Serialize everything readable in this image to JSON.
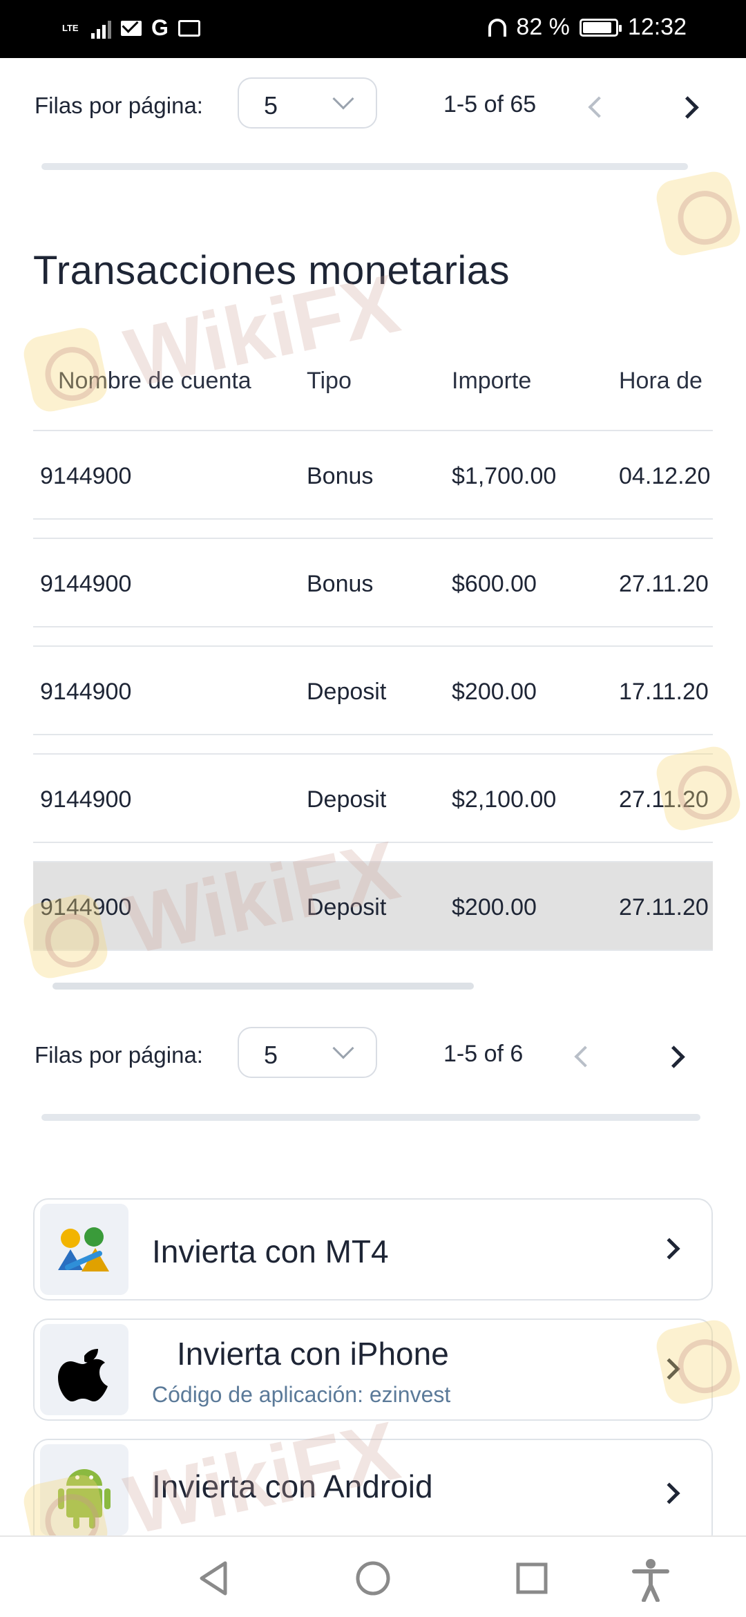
{
  "status_bar": {
    "network": "LTE",
    "battery": "82 %",
    "time": "12:32"
  },
  "pager_top": {
    "label": "Filas por página:",
    "rows_value": "5",
    "range": "1-5 of 65"
  },
  "section": {
    "title": "Transacciones monetarias"
  },
  "table": {
    "columns": [
      "Nombre de cuenta",
      "Tipo",
      "Importe",
      "Hora de"
    ],
    "rows": [
      [
        "9144900",
        "Bonus",
        "$1,700.00",
        "04.12.20"
      ],
      [
        "9144900",
        "Bonus",
        "$600.00",
        "27.11.20"
      ],
      [
        "9144900",
        "Deposit",
        "$200.00",
        "17.11.20"
      ],
      [
        "9144900",
        "Deposit",
        "$2,100.00",
        "27.11.20"
      ],
      [
        "9144900",
        "Deposit",
        "$200.00",
        "27.11.20"
      ]
    ]
  },
  "pager_bottom": {
    "label": "Filas por página:",
    "rows_value": "5",
    "range": "1-5 of 6"
  },
  "app_links": [
    {
      "title": "Invierta con MT4",
      "subtitle": "",
      "icon": "mt4-icon"
    },
    {
      "title": "Invierta con iPhone",
      "subtitle": "Código de aplicación: ezinvest",
      "icon": "apple-icon"
    },
    {
      "title": "Invierta con Android",
      "subtitle": "",
      "icon": "android-icon"
    }
  ],
  "watermark": {
    "text": "WikiFX"
  },
  "colors": {
    "text": "#1e2535",
    "subtitle": "#5b7a99",
    "highlight_row": "#e1e1e1",
    "border": "#e3e6ea"
  }
}
